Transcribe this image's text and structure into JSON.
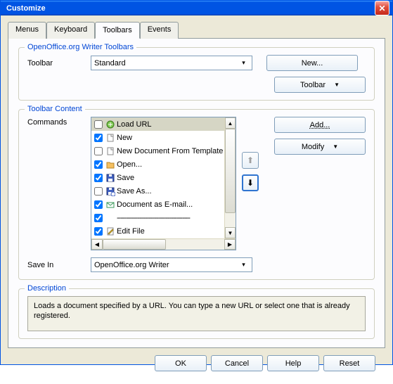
{
  "title": "Customize",
  "tabs": [
    "Menus",
    "Keyboard",
    "Toolbars",
    "Events"
  ],
  "activeTab": 2,
  "toolbarsPanel": {
    "legend": "OpenOffice.org Writer Toolbars",
    "toolbarLabel": "Toolbar",
    "toolbarValue": "Standard",
    "newBtn": "New...",
    "toolbarBtn": "Toolbar"
  },
  "contentPanel": {
    "legend": "Toolbar Content",
    "commandsLabel": "Commands",
    "addBtn": "Add...",
    "modifyBtn": "Modify",
    "items": [
      {
        "checked": false,
        "icon": "load-url",
        "label": "Load URL",
        "selected": true
      },
      {
        "checked": true,
        "icon": "new-doc",
        "label": "New"
      },
      {
        "checked": false,
        "icon": "new-doc",
        "label": "New Document From Template"
      },
      {
        "checked": true,
        "icon": "open",
        "label": "Open..."
      },
      {
        "checked": true,
        "icon": "save",
        "label": "Save"
      },
      {
        "checked": false,
        "icon": "saveas",
        "label": "Save As..."
      },
      {
        "checked": true,
        "icon": "email",
        "label": "Document as E-mail..."
      },
      {
        "checked": true,
        "icon": "sep",
        "label": "---------------------------------------",
        "sep": true
      },
      {
        "checked": true,
        "icon": "edit",
        "label": "Edit File"
      }
    ],
    "saveInLabel": "Save In",
    "saveInValue": "OpenOffice.org Writer"
  },
  "description": {
    "legend": "Description",
    "text": "Loads a document specified by a URL. You can type a new URL or select one that is already registered."
  },
  "footer": {
    "ok": "OK",
    "cancel": "Cancel",
    "help": "Help",
    "reset": "Reset"
  }
}
